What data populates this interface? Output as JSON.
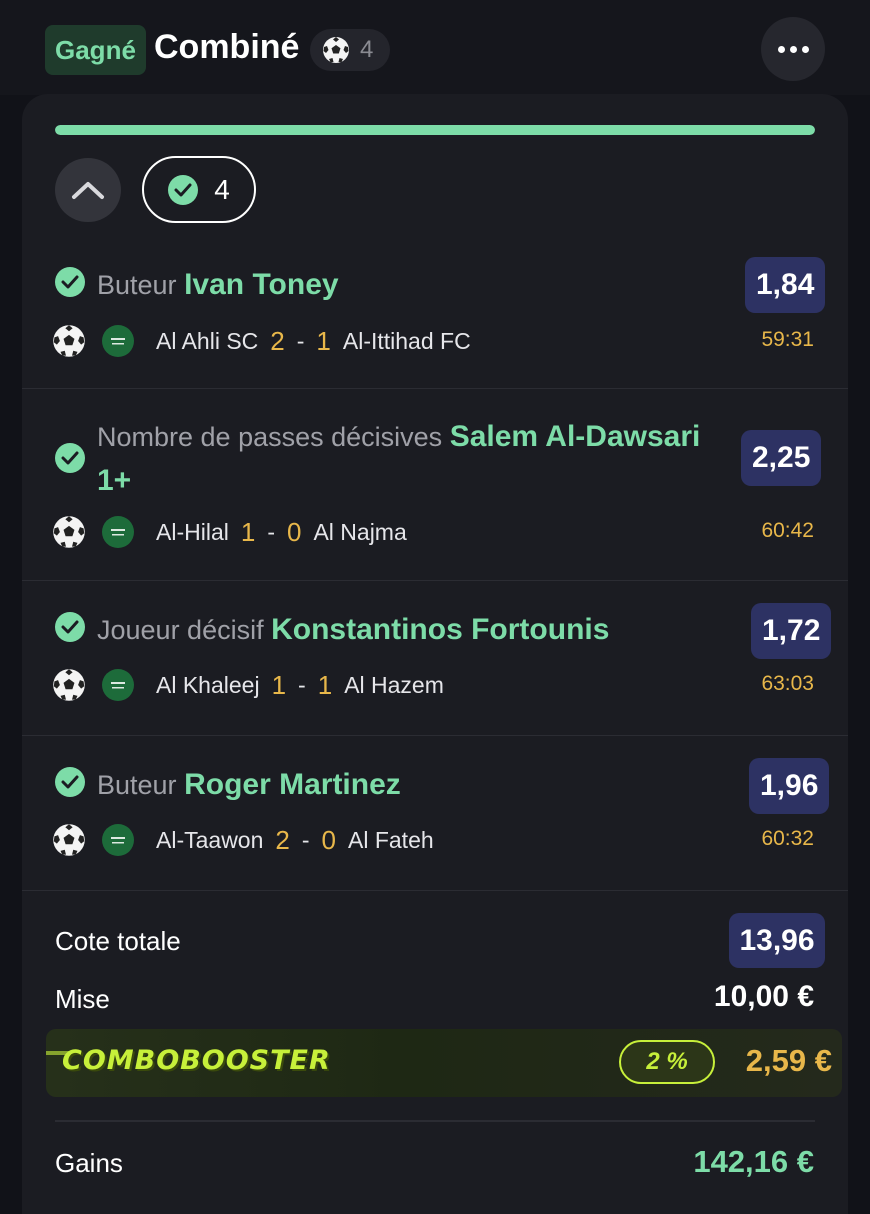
{
  "header": {
    "status": "Gagné",
    "title": "Combiné",
    "sport_icon": "soccer-ball-icon",
    "selection_count": "4",
    "menu_icon": "more-dots-icon"
  },
  "card": {
    "progress": 1.0,
    "won_count": "4"
  },
  "selections": [
    {
      "market": "Buteur",
      "player": "Ivan Toney",
      "odds": "1,84",
      "home": "Al Ahli SC",
      "home_score": "2",
      "away_score": "1",
      "away": "Al-Ittihad FC",
      "time": "59:31"
    },
    {
      "market": "Nombre de passes décisives",
      "player": "Salem Al-Dawsari 1+",
      "odds": "2,25",
      "home": "Al-Hilal",
      "home_score": "1",
      "away_score": "0",
      "away": "Al Najma",
      "time": "60:42"
    },
    {
      "market": "Joueur décisif",
      "player": "Konstantinos Fortounis",
      "odds": "1,72",
      "home": "Al Khaleej",
      "home_score": "1",
      "away_score": "1",
      "away": "Al Hazem",
      "time": "63:03"
    },
    {
      "market": "Buteur",
      "player": "Roger Martinez",
      "odds": "1,96",
      "home": "Al-Taawon",
      "home_score": "2",
      "away_score": "0",
      "away": "Al Fateh",
      "time": "60:32"
    }
  ],
  "summary": {
    "total_odds_label": "Cote totale",
    "total_odds": "13,96",
    "stake_label": "Mise",
    "stake": "10,00 €",
    "booster_logo": "COMBOBOOSTER",
    "booster_percent": "2 %",
    "booster_amount": "2,59 €",
    "winnings_label": "Gains",
    "winnings": "142,16 €"
  },
  "colors": {
    "accent_green": "#7ddca8",
    "odds_badge": "#2d3263",
    "score_yellow": "#e8b74a",
    "booster_lime": "#c7f03a"
  }
}
